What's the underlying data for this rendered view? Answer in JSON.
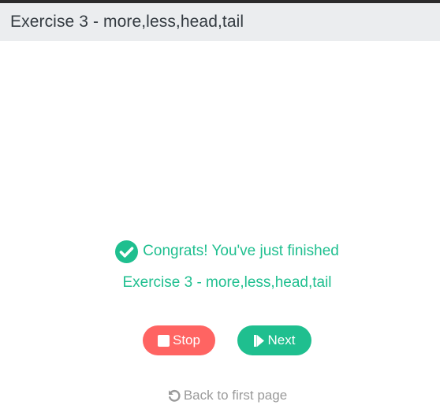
{
  "header": {
    "title": "Exercise 3 - more,less,head,tail"
  },
  "result": {
    "message_line1": "Congrats! You've just finished",
    "message_line2": "Exercise 3 - more,less,head,tail",
    "icon": "check-circle-icon"
  },
  "actions": {
    "stop_label": "Stop",
    "stop_icon": "stop-icon",
    "next_label": "Next",
    "next_icon": "step-forward-icon"
  },
  "footer": {
    "back_label": "Back to first page",
    "back_icon": "undo-icon"
  },
  "colors": {
    "accent_green": "#1fbf8f",
    "stop_red": "#ff6462",
    "header_bg": "#ebedef",
    "muted_text": "#9a9a9a"
  }
}
